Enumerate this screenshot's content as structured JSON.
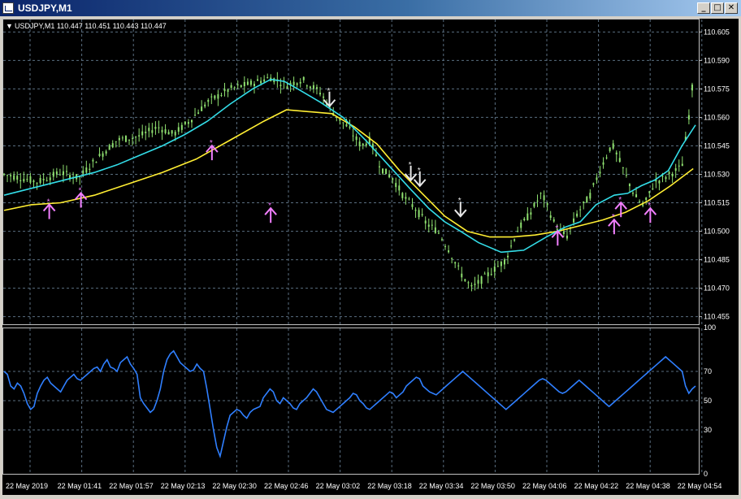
{
  "window": {
    "title": "USDJPY,M1",
    "buttons": {
      "minimize": "_",
      "maximize": "□",
      "close": "✕"
    }
  },
  "chart_header": {
    "arrow": "▼",
    "label": "USDJPY,M1  110.447 110.451 110.443 110.447"
  },
  "colors": {
    "background": "#000000",
    "grid": "#5a6e80",
    "candles": "#8fe070",
    "ma_fast": "#33dde8",
    "ma_slow": "#ffee33",
    "buy_arrow": "#f27fff",
    "sell_arrow": "#e8e8e8",
    "oscillator": "#2f7fff",
    "axis_text": "#ffffff"
  },
  "chart_data": [
    {
      "type": "line",
      "panel": "price",
      "price_axis_ticks": [
        "110.605",
        "110.590",
        "110.575",
        "110.560",
        "110.545",
        "110.530",
        "110.515",
        "110.500",
        "110.485",
        "110.470",
        "110.455"
      ],
      "ylim": [
        110.451,
        110.609
      ],
      "time_labels": [
        "22 May 2019",
        "22 May 01:41",
        "22 May 01:57",
        "22 May 02:13",
        "22 May 02:30",
        "22 May 02:46",
        "22 May 03:02",
        "22 May 03:18",
        "22 May 03:34",
        "22 May 03:50",
        "22 May 04:06",
        "22 May 04:22",
        "22 May 04:38",
        "22 May 04:54"
      ],
      "bars": 210,
      "close_path": [
        [
          0,
          110.53
        ],
        [
          8,
          110.528
        ],
        [
          15,
          110.526
        ],
        [
          25,
          110.531
        ],
        [
          33,
          110.528
        ],
        [
          40,
          110.537
        ],
        [
          50,
          110.548
        ],
        [
          60,
          110.55
        ],
        [
          68,
          110.555
        ],
        [
          75,
          110.551
        ],
        [
          82,
          110.558
        ],
        [
          90,
          110.568
        ],
        [
          100,
          110.575
        ],
        [
          110,
          110.578
        ],
        [
          118,
          110.581
        ],
        [
          125,
          110.577
        ],
        [
          132,
          110.58
        ],
        [
          140,
          110.573
        ],
        [
          146,
          110.562
        ],
        [
          152,
          110.555
        ],
        [
          158,
          110.545
        ],
        [
          162,
          110.548
        ],
        [
          167,
          110.533
        ],
        [
          172,
          110.528
        ],
        [
          177,
          110.518
        ],
        [
          182,
          110.512
        ],
        [
          187,
          110.504
        ],
        [
          192,
          110.5
        ],
        [
          197,
          110.49
        ],
        [
          202,
          110.478
        ],
        [
          207,
          110.47
        ],
        [
          212,
          110.475
        ],
        [
          217,
          110.48
        ],
        [
          222,
          110.485
        ],
        [
          227,
          110.5
        ],
        [
          232,
          110.508
        ],
        [
          238,
          110.52
        ],
        [
          244,
          110.503
        ],
        [
          249,
          110.497
        ],
        [
          254,
          110.51
        ],
        [
          259,
          110.518
        ],
        [
          264,
          110.533
        ],
        [
          269,
          110.546
        ],
        [
          275,
          110.53
        ],
        [
          279,
          110.519
        ],
        [
          283,
          110.513
        ],
        [
          288,
          110.526
        ],
        [
          292,
          110.528
        ],
        [
          296,
          110.531
        ],
        [
          300,
          110.534
        ],
        [
          303,
          110.56
        ],
        [
          306,
          110.59
        ],
        [
          309,
          110.589
        ]
      ],
      "series": [
        {
          "name": "",
          "role": "ma_fast",
          "points": [
            [
              0,
              110.519
            ],
            [
              10,
              110.522
            ],
            [
              20,
              110.525
            ],
            [
              30,
              110.528
            ],
            [
              40,
              110.531
            ],
            [
              50,
              110.535
            ],
            [
              60,
              110.54
            ],
            [
              70,
              110.545
            ],
            [
              80,
              110.551
            ],
            [
              90,
              110.558
            ],
            [
              100,
              110.567
            ],
            [
              110,
              110.575
            ],
            [
              118,
              110.58
            ],
            [
              124,
              110.579
            ],
            [
              130,
              110.575
            ],
            [
              140,
              110.568
            ],
            [
              150,
              110.56
            ],
            [
              160,
              110.548
            ],
            [
              170,
              110.535
            ],
            [
              180,
              110.522
            ],
            [
              188,
              110.512
            ],
            [
              195,
              110.505
            ],
            [
              202,
              110.5
            ],
            [
              210,
              110.494
            ],
            [
              220,
              110.489
            ],
            [
              230,
              110.49
            ],
            [
              240,
              110.497
            ],
            [
              248,
              110.502
            ],
            [
              255,
              110.505
            ],
            [
              262,
              110.514
            ],
            [
              270,
              110.519
            ],
            [
              276,
              110.52
            ],
            [
              282,
              110.524
            ],
            [
              288,
              110.527
            ],
            [
              294,
              110.532
            ],
            [
              300,
              110.545
            ],
            [
              306,
              110.556
            ]
          ]
        },
        {
          "name": "",
          "role": "ma_slow",
          "points": [
            [
              0,
              110.511
            ],
            [
              12,
              110.514
            ],
            [
              25,
              110.515
            ],
            [
              40,
              110.519
            ],
            [
              55,
              110.525
            ],
            [
              70,
              110.531
            ],
            [
              85,
              110.538
            ],
            [
              100,
              110.548
            ],
            [
              115,
              110.558
            ],
            [
              125,
              110.564
            ],
            [
              135,
              110.563
            ],
            [
              145,
              110.562
            ],
            [
              155,
              110.555
            ],
            [
              165,
              110.546
            ],
            [
              175,
              110.532
            ],
            [
              185,
              110.52
            ],
            [
              195,
              110.508
            ],
            [
              205,
              110.5
            ],
            [
              215,
              110.497
            ],
            [
              225,
              110.497
            ],
            [
              235,
              110.498
            ],
            [
              245,
              110.5
            ],
            [
              255,
              110.503
            ],
            [
              265,
              110.506
            ],
            [
              275,
              110.51
            ],
            [
              285,
              110.516
            ],
            [
              295,
              110.524
            ],
            [
              305,
              110.533
            ]
          ]
        }
      ],
      "buy_signals": [
        [
          20,
          110.515
        ],
        [
          34,
          110.521
        ],
        [
          92,
          110.546
        ],
        [
          118,
          110.513
        ],
        [
          245,
          110.501
        ],
        [
          270,
          110.507
        ],
        [
          273,
          110.516
        ],
        [
          286,
          110.513
        ]
      ],
      "sell_signals": [
        [
          144,
          110.565
        ],
        [
          180,
          110.526
        ],
        [
          184,
          110.523
        ],
        [
          202,
          110.507
        ]
      ]
    },
    {
      "type": "line",
      "panel": "oscillator",
      "name": "",
      "ylim": [
        0,
        100
      ],
      "levels_printed": [
        "100",
        "70",
        "50",
        "30",
        "0"
      ],
      "level_lines": [
        70,
        50,
        30
      ],
      "values": [
        70,
        68,
        60,
        58,
        62,
        60,
        55,
        48,
        44,
        46,
        55,
        60,
        64,
        66,
        62,
        60,
        58,
        56,
        60,
        64,
        66,
        68,
        65,
        64,
        66,
        68,
        70,
        72,
        73,
        70,
        75,
        78,
        73,
        72,
        70,
        76,
        78,
        80,
        75,
        72,
        68,
        52,
        48,
        45,
        42,
        44,
        50,
        58,
        70,
        78,
        82,
        84,
        80,
        76,
        74,
        72,
        70,
        71,
        75,
        72,
        70,
        58,
        44,
        30,
        18,
        12,
        22,
        32,
        40,
        42,
        44,
        43,
        40,
        38,
        42,
        44,
        45,
        46,
        52,
        55,
        58,
        56,
        50,
        48,
        52,
        50,
        48,
        45,
        44,
        48,
        50,
        52,
        55,
        58,
        56,
        52,
        48,
        44,
        43,
        42,
        44,
        46,
        48,
        50,
        52,
        55,
        54,
        50,
        48,
        45,
        44,
        46,
        48,
        50,
        52,
        54,
        56,
        55,
        52,
        54,
        56,
        60,
        62,
        64,
        66,
        65,
        60,
        58,
        56,
        55,
        54,
        56,
        58,
        60,
        62,
        64,
        66,
        68,
        70,
        68,
        66,
        64,
        62,
        60,
        58,
        56,
        54,
        52,
        50,
        48,
        46,
        44,
        46,
        48,
        50,
        52,
        54,
        56,
        58,
        60,
        62,
        64,
        65,
        64,
        62,
        60,
        58,
        56,
        55,
        56,
        58,
        60,
        62,
        64,
        62,
        60,
        58,
        56,
        54,
        52,
        50,
        48,
        46,
        48,
        50,
        52,
        54,
        56,
        58,
        60,
        62,
        64,
        66,
        68,
        70,
        72,
        74,
        76,
        78,
        80,
        78,
        76,
        74,
        72,
        70,
        60,
        55,
        58,
        60
      ],
      "values_note_free": true
    }
  ]
}
